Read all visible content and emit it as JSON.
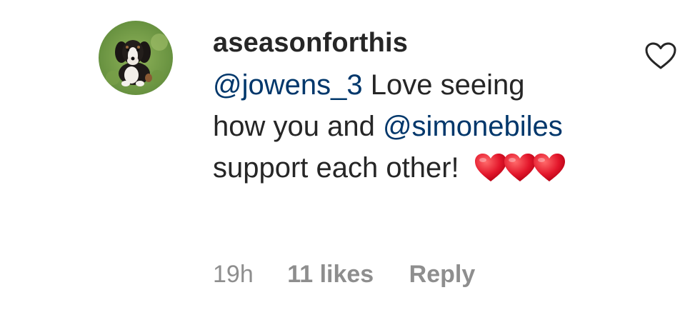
{
  "comment": {
    "username": "aseasonforthis",
    "mention_1": "@jowens_3",
    "text_1": " Love seeing how you and ",
    "mention_2": "@simonebiles",
    "text_2": " support each other! ",
    "hearts_emoji": "❤️❤️❤️",
    "timestamp": "19h",
    "likes": "11 likes",
    "reply_label": "Reply",
    "avatar_icon": "dog-avatar-icon",
    "like_icon": "heart-outline-icon"
  },
  "colors": {
    "text": "#262626",
    "mention": "#00376b",
    "meta": "#8e8e8e",
    "heart_emoji": "#e0142a"
  }
}
